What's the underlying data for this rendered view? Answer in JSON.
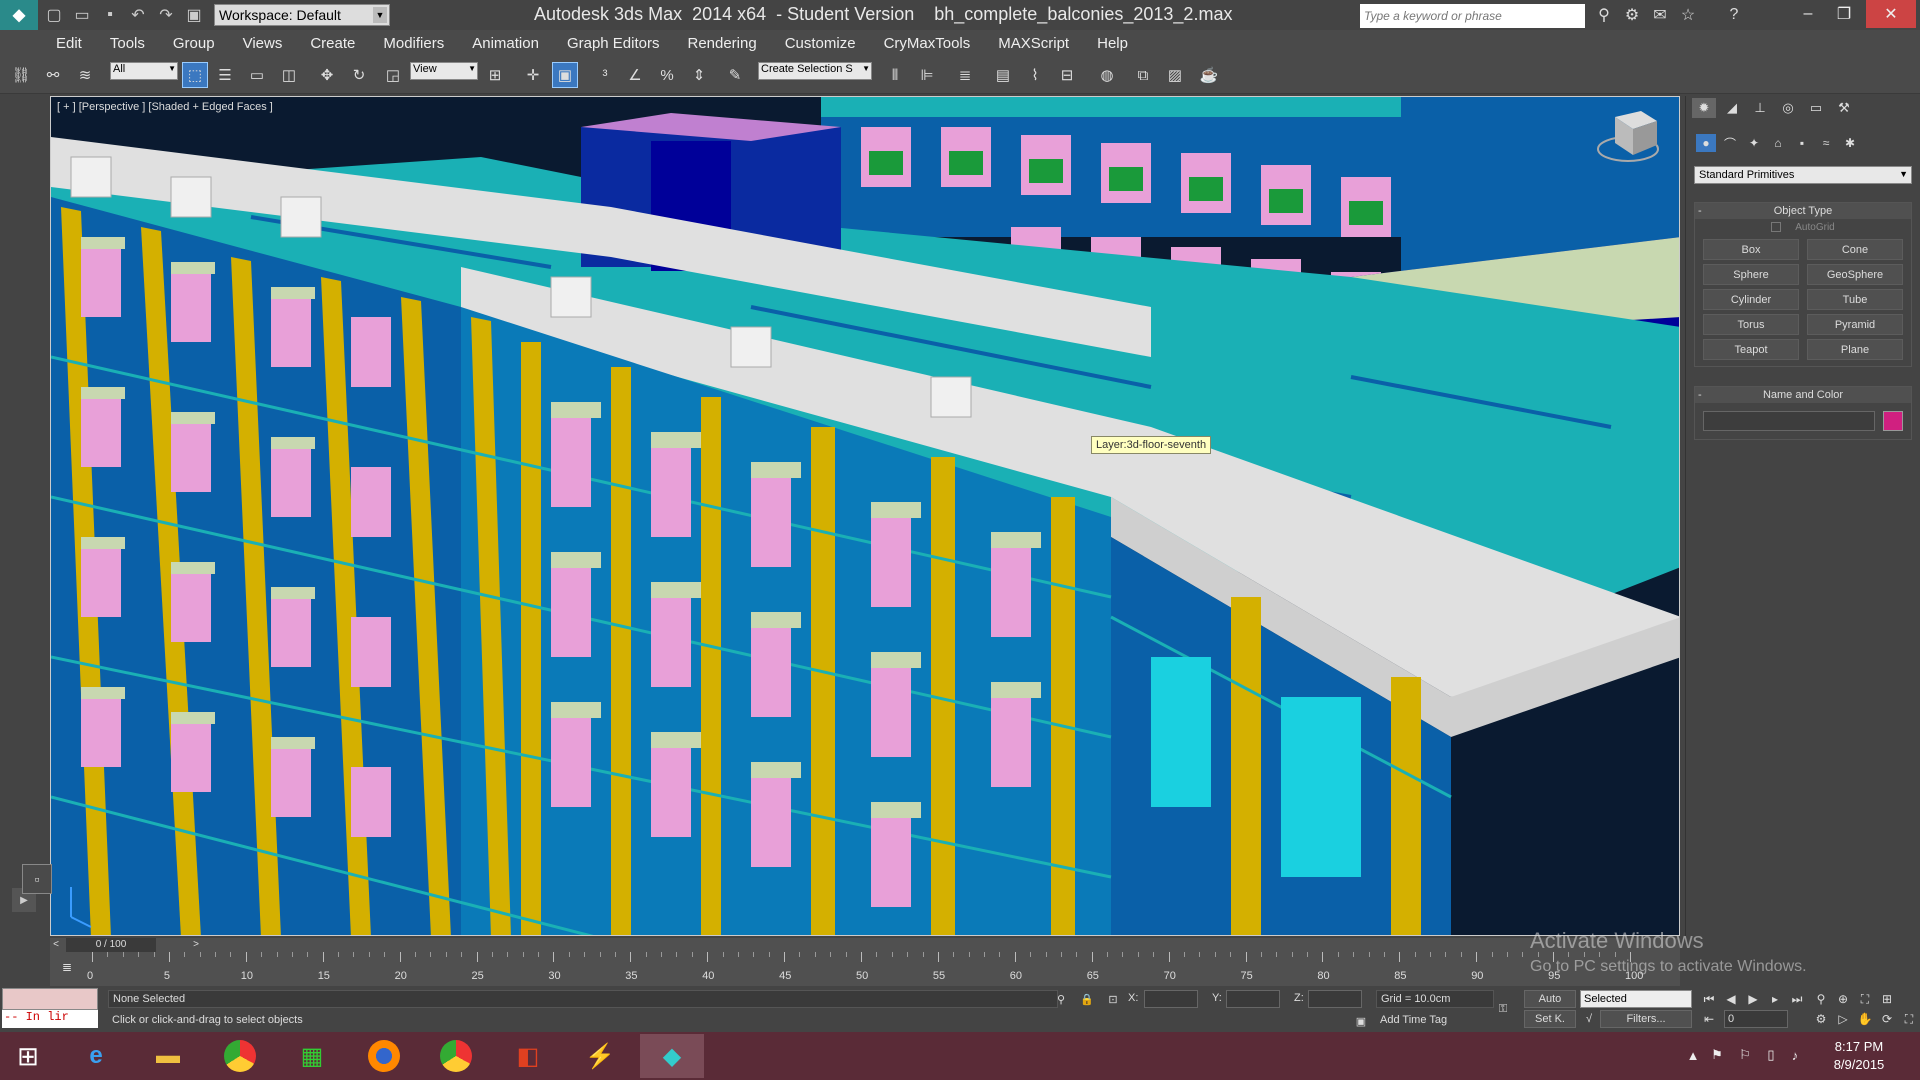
{
  "title_bar": {
    "workspace_label": "Workspace: Default",
    "title": "Autodesk 3ds Max  2014 x64  - Student Version    bh_complete_balconies_2013_2.max",
    "search_placeholder": "Type a keyword or phrase"
  },
  "menu": [
    "Edit",
    "Tools",
    "Group",
    "Views",
    "Create",
    "Modifiers",
    "Animation",
    "Graph Editors",
    "Rendering",
    "Customize",
    "CryMaxTools",
    "MAXScript",
    "Help"
  ],
  "toolbar": {
    "selection_filter": "All",
    "reference_coord": "View",
    "named_selection": "Create Selection S"
  },
  "viewport": {
    "label": "[ + ] [Perspective ] [Shaded + Edged Faces ]",
    "tooltip": "Layer:3d-floor-seventh",
    "scene_colors": {
      "teal": "#1ab0b5",
      "blue_wall": "#0a60a8",
      "yellow_column": "#d4b000",
      "pink_panel": "#e8a0d8",
      "light_slab": "#c8d8b0",
      "dark_blue": "#000099",
      "white_parapet": "#e0e0e0",
      "purple_top": "#c080d0",
      "green_railing": "#1a9a3a"
    }
  },
  "command_panel": {
    "primitives_dropdown": "Standard Primitives",
    "object_type_title": "Object Type",
    "autogrid_label": "AutoGrid",
    "primitives": [
      "Box",
      "Cone",
      "Sphere",
      "GeoSphere",
      "Cylinder",
      "Tube",
      "Torus",
      "Pyramid",
      "Teapot",
      "Plane"
    ],
    "name_color_title": "Name and Color",
    "object_color": "#d02080"
  },
  "timeline": {
    "frame_readout": "0 / 100",
    "ticks": [
      "0",
      "5",
      "10",
      "15",
      "20",
      "25",
      "30",
      "35",
      "40",
      "45",
      "50",
      "55",
      "60",
      "65",
      "70",
      "75",
      "80",
      "85",
      "90",
      "95",
      "100"
    ]
  },
  "status": {
    "selection": "None Selected",
    "prompt": "Click or click-and-drag to select objects",
    "script_text": "-- In lir",
    "x_label": "X:",
    "y_label": "Y:",
    "z_label": "Z:",
    "grid": "Grid = 10.0cm",
    "add_time_tag": "Add Time Tag",
    "auto_key": "Auto",
    "set_key": "Set K.",
    "key_filter": "Selected",
    "filters": "Filters...",
    "current_frame": "0"
  },
  "watermark": {
    "line1": "Activate Windows",
    "line2": "Go to PC settings to activate Windows."
  },
  "taskbar": {
    "time": "8:17 PM",
    "date": "8/9/2015",
    "apps": [
      "internet-explorer",
      "file-explorer",
      "chrome",
      "store",
      "firefox",
      "chrome",
      "office",
      "crytek-sandbox",
      "3ds-max"
    ]
  }
}
